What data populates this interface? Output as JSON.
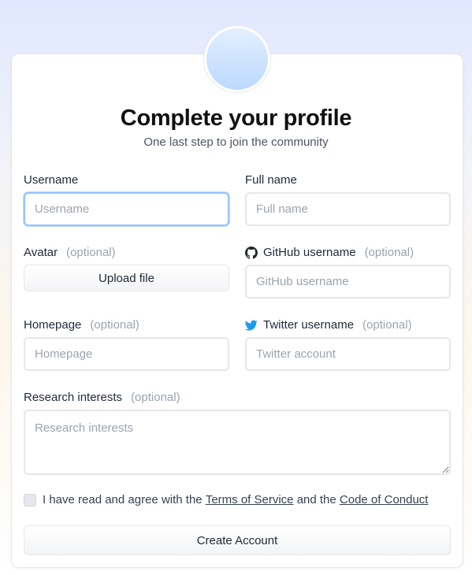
{
  "header": {
    "title": "Complete your profile",
    "subtitle": "One last step to join the community"
  },
  "fields": {
    "username": {
      "label": "Username",
      "placeholder": "Username",
      "value": ""
    },
    "fullname": {
      "label": "Full name",
      "placeholder": "Full name",
      "value": ""
    },
    "avatar": {
      "label": "Avatar",
      "optional": "(optional)",
      "button": "Upload file"
    },
    "github": {
      "label": "GitHub username",
      "optional": "(optional)",
      "placeholder": "GitHub username",
      "icon": "github-icon"
    },
    "homepage": {
      "label": "Homepage",
      "optional": "(optional)",
      "placeholder": "Homepage"
    },
    "twitter": {
      "label": "Twitter username",
      "optional": "(optional)",
      "placeholder": "Twitter account",
      "icon": "twitter-icon"
    },
    "research": {
      "label": "Research interests",
      "optional": "(optional)",
      "placeholder": "Research interests"
    }
  },
  "agreement": {
    "prefix": "I have read and agree with the",
    "tos": "Terms of Service",
    "middle": "and the",
    "coc": "Code of Conduct",
    "checked": false
  },
  "actions": {
    "create_label": "Create Account"
  },
  "colors": {
    "focus_border": "#93c5fd",
    "twitter_blue": "#1d9bf0",
    "avatar_gradient_top": "#e3efff",
    "avatar_gradient_bottom": "#bcd9ff"
  }
}
